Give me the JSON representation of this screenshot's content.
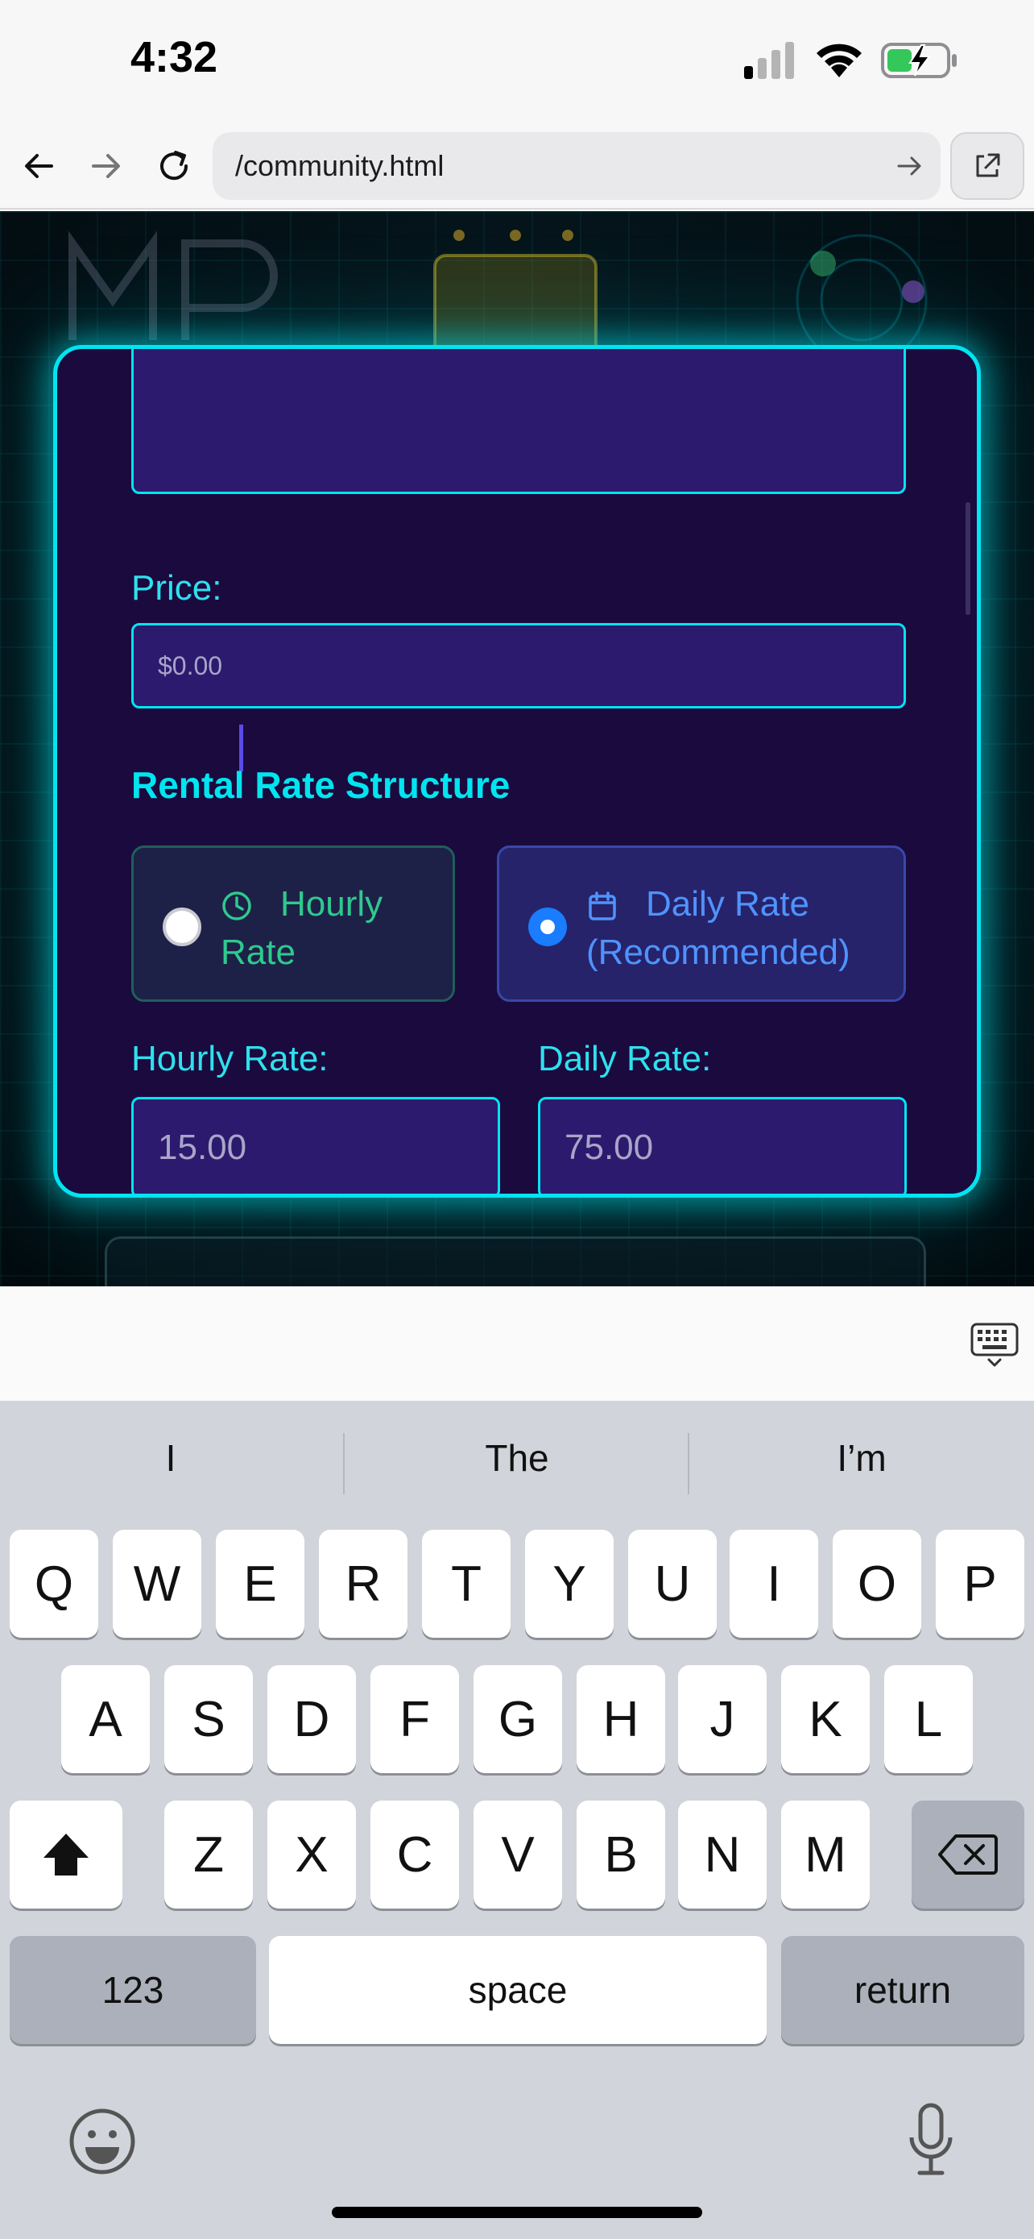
{
  "status_bar": {
    "time": "4:32"
  },
  "browser": {
    "url": "/community.html"
  },
  "form": {
    "price_label": "Price:",
    "price_placeholder": "$0.00",
    "section_heading": "Rental Rate Structure",
    "options": [
      {
        "label": "Hourly Rate",
        "selected": false,
        "icon": "clock-icon"
      },
      {
        "label": "Daily Rate (Recommended)",
        "selected": true,
        "icon": "calendar-icon"
      }
    ],
    "hourly_label": "Hourly Rate:",
    "hourly_placeholder": "15.00",
    "daily_label": "Daily Rate:",
    "daily_placeholder": "75.00"
  },
  "keyboard": {
    "suggestions": [
      "I",
      "The",
      "I’m"
    ],
    "row1": [
      "Q",
      "W",
      "E",
      "R",
      "T",
      "Y",
      "U",
      "I",
      "O",
      "P"
    ],
    "row2": [
      "A",
      "S",
      "D",
      "F",
      "G",
      "H",
      "J",
      "K",
      "L"
    ],
    "row3": [
      "Z",
      "X",
      "C",
      "V",
      "B",
      "N",
      "M"
    ],
    "numbers_label": "123",
    "space_label": "space",
    "return_label": "return"
  },
  "colors": {
    "accent": "#00e5f0",
    "modal_bg": "#1a0a3e",
    "input_bg": "#2c1a6e",
    "hourly_text": "#2fc98e",
    "daily_text": "#4f93ff",
    "radio_selected": "#1a7cff"
  }
}
